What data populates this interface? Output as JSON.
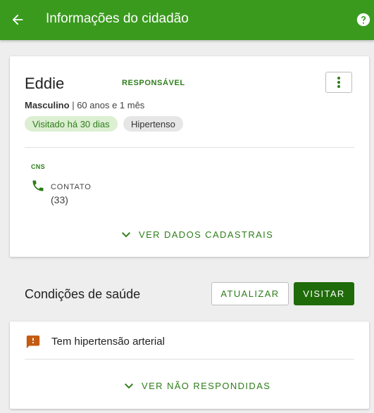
{
  "appbar": {
    "title": "Informações do cidadão",
    "color": "#3a9a1e"
  },
  "citizen": {
    "name": "Eddie",
    "role": "RESPONSÁVEL",
    "sex": "Masculino",
    "age": "| 60 anos e 1 mês",
    "chips": {
      "visited": "Visitado há 30 dias",
      "condition": "Hipertenso"
    },
    "cns_label": "CNS",
    "contact_label": "CONTATO",
    "contact_value": "(33)",
    "view_data_link": "VER DADOS CADASTRAIS"
  },
  "health": {
    "title": "Condições de saúde",
    "update_button": "ATUALIZAR",
    "visit_button": "VISITAR",
    "conditions": [
      {
        "label": "Tem hipertensão arterial",
        "icon": "alert-comment-icon"
      }
    ],
    "unanswered_link": "VER NÃO RESPONDIDAS"
  },
  "colors": {
    "primary_dark": "#1f6b0a",
    "accent_text": "#2e7d1a",
    "alert": "#c55a11"
  }
}
